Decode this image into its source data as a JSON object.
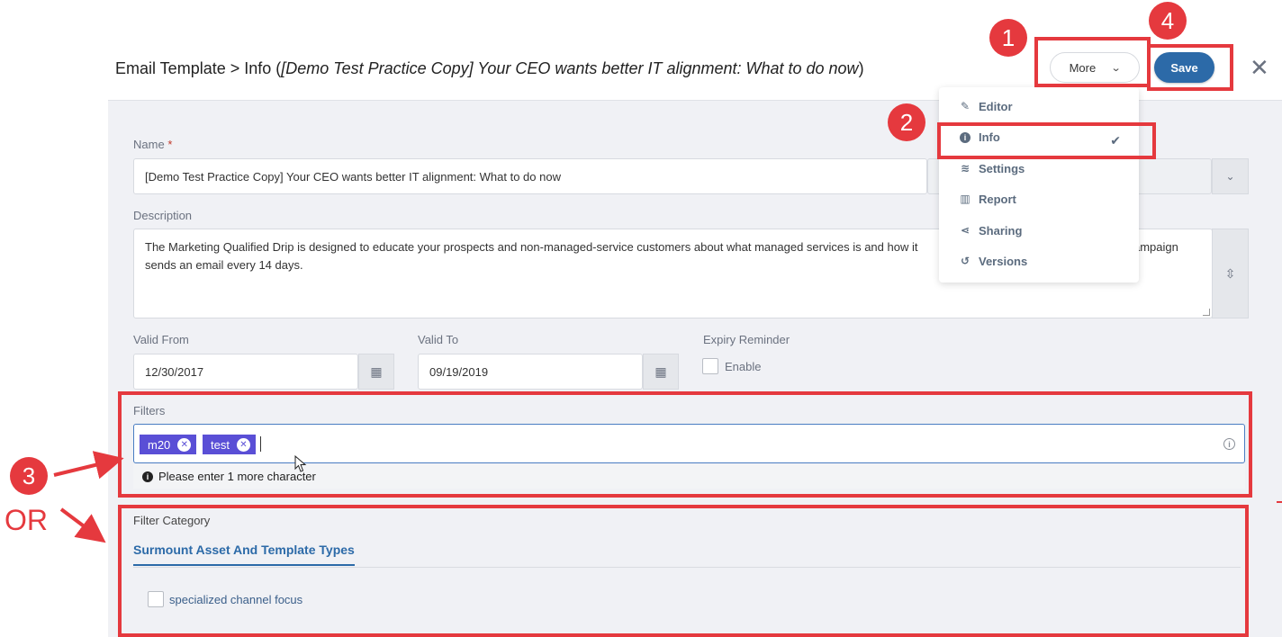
{
  "header": {
    "title_prefix": "Email Template > Info (",
    "title_italic": "[Demo Test Practice Copy] Your CEO wants better IT alignment: What to do now",
    "title_suffix": ")",
    "more_label": "More",
    "save_label": "Save",
    "close_glyph": "✕"
  },
  "menu": {
    "items": [
      {
        "label": "Editor",
        "icon": "✎"
      },
      {
        "label": "Info",
        "icon": "i"
      },
      {
        "label": "Settings",
        "icon": "≋"
      },
      {
        "label": "Report",
        "icon": "▥"
      },
      {
        "label": "Sharing",
        "icon": "⋖"
      },
      {
        "label": "Versions",
        "icon": "↺"
      }
    ],
    "checked_glyph": "✔"
  },
  "form": {
    "name_label": "Name",
    "required_mark": "*",
    "name_value": "[Demo Test Practice Copy] Your CEO wants better IT alignment: What to do now",
    "description_label": "Description",
    "description_value": "The Marketing Qualified Drip is designed to educate your prospects and non-managed-service customers about what managed services is and how it",
    "description_value_right": "ampaign",
    "description_line2": "sends an email every 14 days.",
    "valid_from_label": "Valid From",
    "valid_from_value": "12/30/2017",
    "valid_to_label": "Valid To",
    "valid_to_value": "09/19/2019",
    "expiry_label": "Expiry Reminder",
    "enable_label": "Enable",
    "filters_label": "Filters",
    "tags": [
      "m20",
      "test"
    ],
    "hint_text": "Please enter 1 more character",
    "filter_category_label": "Filter Category",
    "tab_label": "Surmount Asset And Template Types",
    "checkbox_item_label": "specialized channel focus"
  },
  "annotations": {
    "badges": [
      "1",
      "2",
      "3",
      "4"
    ],
    "or_text": "OR",
    "color": "#e5393e"
  }
}
